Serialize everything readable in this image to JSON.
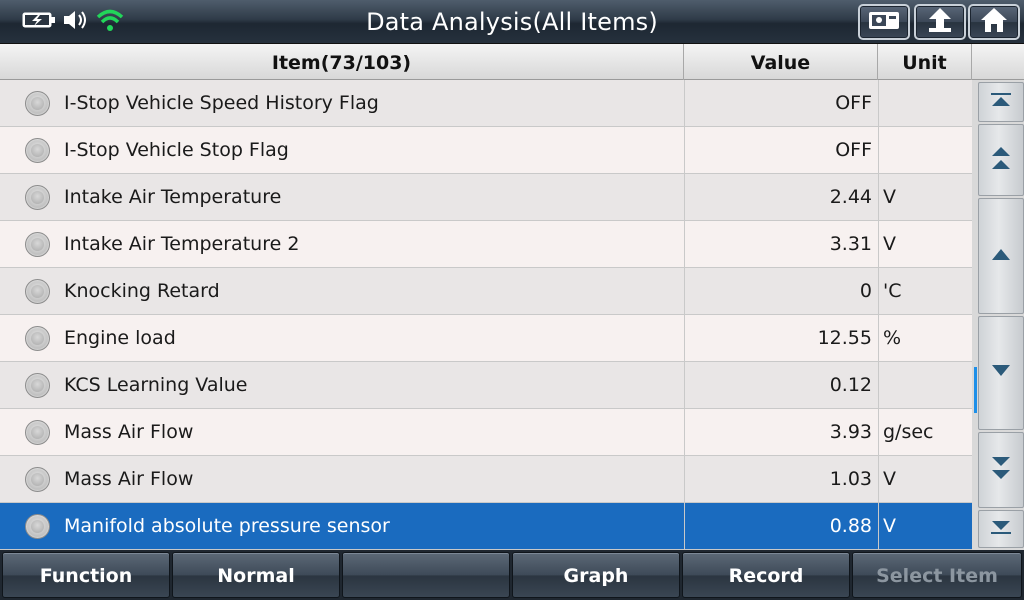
{
  "header": {
    "title": "Data Analysis(All Items)"
  },
  "table": {
    "columns": {
      "item": "Item(73/103)",
      "value": "Value",
      "unit": "Unit"
    },
    "rows": [
      {
        "name": "I-Stop Vehicle Speed History Flag",
        "value": "OFF",
        "unit": ""
      },
      {
        "name": "I-Stop Vehicle Stop Flag",
        "value": "OFF",
        "unit": ""
      },
      {
        "name": "Intake Air Temperature",
        "value": "2.44",
        "unit": "V"
      },
      {
        "name": "Intake Air Temperature 2",
        "value": "3.31",
        "unit": "V"
      },
      {
        "name": "Knocking Retard",
        "value": "0",
        "unit": "'C"
      },
      {
        "name": "Engine load",
        "value": "12.55",
        "unit": "%"
      },
      {
        "name": "KCS Learning Value",
        "value": "0.12",
        "unit": ""
      },
      {
        "name": "Mass Air Flow",
        "value": "3.93",
        "unit": "g/sec"
      },
      {
        "name": "Mass Air Flow",
        "value": "1.03",
        "unit": "V"
      },
      {
        "name": "Manifold absolute pressure sensor",
        "value": "0.88",
        "unit": "V"
      }
    ]
  },
  "toolbar": {
    "function_label": "Function",
    "normal_label": "Normal",
    "blank_label": "",
    "graph_label": "Graph",
    "record_label": "Record",
    "select_item_label": "Select Item"
  },
  "colors": {
    "selected_row": "#1a6bbf",
    "wifi": "#22d65a",
    "scroll_indicator": "#1e8fe8"
  }
}
